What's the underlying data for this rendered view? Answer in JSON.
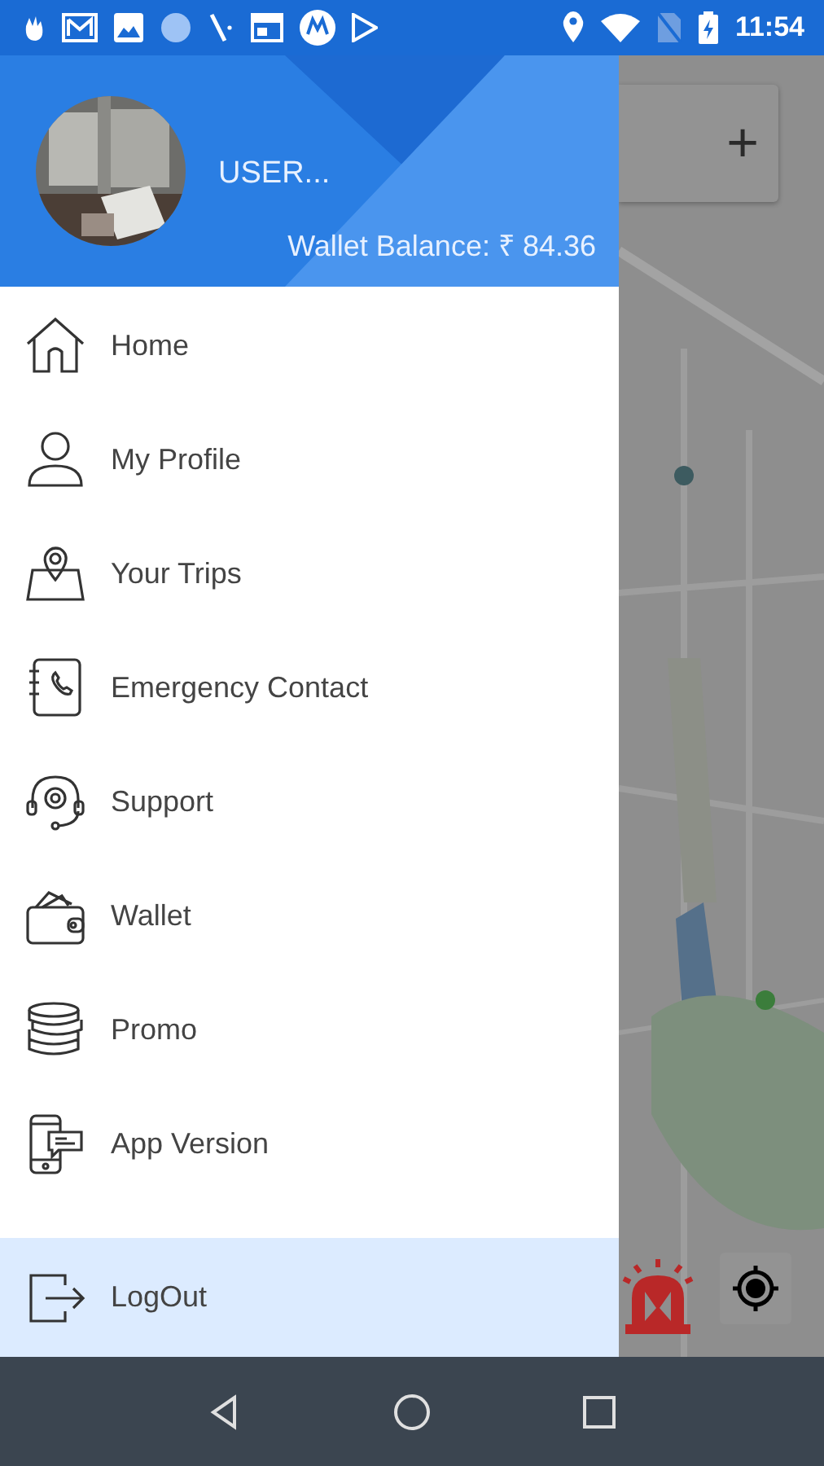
{
  "status_bar": {
    "time": "11:54"
  },
  "drawer": {
    "header": {
      "user_name": "USER...",
      "wallet_balance": "Wallet Balance: ₹ 84.36"
    },
    "items": [
      {
        "label": "Home",
        "selected": false
      },
      {
        "label": "My Profile",
        "selected": false
      },
      {
        "label": "Your Trips",
        "selected": false
      },
      {
        "label": "Emergency Contact",
        "selected": false
      },
      {
        "label": "Support",
        "selected": false
      },
      {
        "label": "Wallet",
        "selected": false
      },
      {
        "label": "Promo",
        "selected": false
      },
      {
        "label": "App Version",
        "selected": false
      }
    ],
    "footer_item": {
      "label": "LogOut",
      "selected": true
    }
  },
  "map": {
    "zoom_button": "+"
  }
}
